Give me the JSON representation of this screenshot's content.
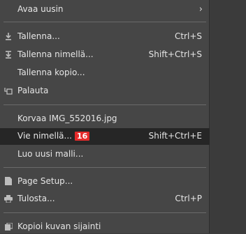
{
  "menu": {
    "items": [
      {
        "label": "Avaa uusin",
        "shortcut": "",
        "icon": "none",
        "submenu": true
      },
      {
        "label": "Tallenna...",
        "shortcut": "Ctrl+S",
        "icon": "save-icon"
      },
      {
        "label": "Tallenna nimellä...",
        "shortcut": "Shift+Ctrl+S",
        "icon": "save-as-icon"
      },
      {
        "label": "Tallenna kopio...",
        "shortcut": "",
        "icon": "none"
      },
      {
        "label": "Palauta",
        "shortcut": "",
        "icon": "revert-icon"
      },
      {
        "label": "Korvaa IMG_552016.jpg",
        "shortcut": "",
        "icon": "none"
      },
      {
        "label": "Vie nimellä...",
        "shortcut": "Shift+Ctrl+E",
        "icon": "none",
        "badge": "16",
        "highlighted": true
      },
      {
        "label": "Luo uusi malli...",
        "shortcut": "",
        "icon": "none"
      },
      {
        "label": "Page Setup...",
        "shortcut": "",
        "icon": "page-setup-icon"
      },
      {
        "label": "Tulosta...",
        "shortcut": "Ctrl+P",
        "icon": "print-icon"
      },
      {
        "label": "Kopioi kuvan sijainti",
        "shortcut": "",
        "icon": "copy-location-icon"
      }
    ]
  },
  "colors": {
    "menu_bg": "#464646",
    "highlight_bg": "#262626",
    "badge_bg": "#e62a2a",
    "text": "#e6e6e6"
  }
}
